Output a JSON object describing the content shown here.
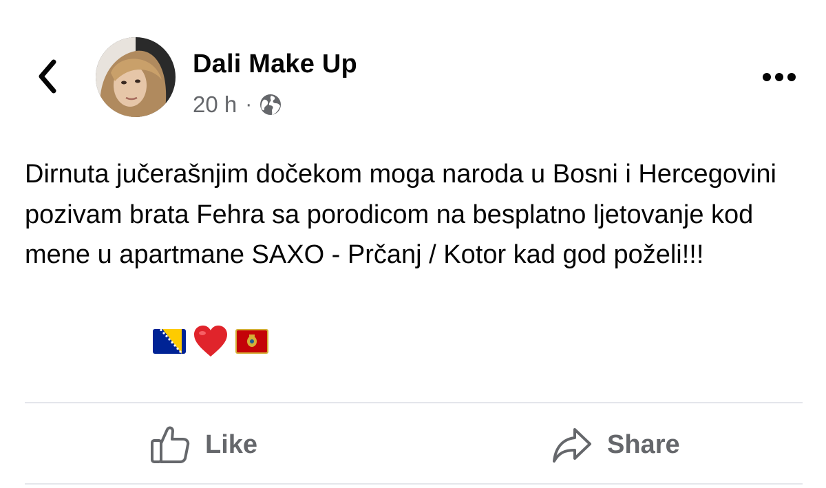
{
  "post": {
    "author": "Dali Make Up",
    "time": "20 h",
    "separator": "·",
    "privacy_icon": "globe-icon",
    "text": "Dirnuta jučerašnjim dočekom moga naroda u Bosni i Hercegovini pozivam brata Fehra sa porodicom na besplatno ljetovanje kod mene u apartmane SAXO - Prčanj / Kotor kad god poželi!!!",
    "emojis": [
      "bosnia-flag",
      "red-heart",
      "montenegro-flag"
    ]
  },
  "actions": {
    "like_label": "Like",
    "share_label": "Share"
  },
  "colors": {
    "text": "#050505",
    "secondary": "#65676b",
    "divider": "#e4e6eb"
  }
}
